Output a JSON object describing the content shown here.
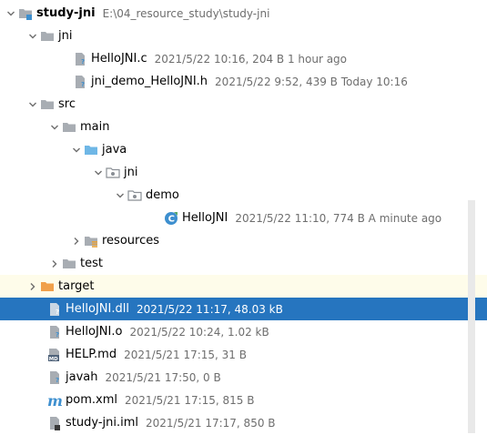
{
  "tree": {
    "project": {
      "name": "study-jni",
      "path": "E:\\04_resource_study\\study-jni"
    },
    "jni_folder": {
      "name": "jni"
    },
    "hellojni_c": {
      "name": "HelloJNI.c",
      "meta": "2021/5/22 10:16, 204 B 1 hour ago"
    },
    "jni_demo_h": {
      "name": "jni_demo_HelloJNI.h",
      "meta": "2021/5/22 9:52, 439 B Today 10:16"
    },
    "src": {
      "name": "src"
    },
    "main": {
      "name": "main"
    },
    "java": {
      "name": "java"
    },
    "pkg_jni": {
      "name": "jni"
    },
    "pkg_demo": {
      "name": "demo"
    },
    "hellojni_class": {
      "name": "HelloJNI",
      "meta": "2021/5/22 11:10, 774 B A minute ago"
    },
    "resources": {
      "name": "resources"
    },
    "test": {
      "name": "test"
    },
    "target": {
      "name": "target"
    },
    "hellojni_dll": {
      "name": "HelloJNI.dll",
      "meta": "2021/5/22 11:17, 48.03 kB"
    },
    "hellojni_o": {
      "name": "HelloJNI.o",
      "meta": "2021/5/22 10:24, 1.02 kB"
    },
    "help_md": {
      "name": "HELP.md",
      "meta": "2021/5/21 17:15, 31 B",
      "icon_text": "MD"
    },
    "javah": {
      "name": "javah",
      "meta": "2021/5/21 17:50, 0 B"
    },
    "pom_xml": {
      "name": "pom.xml",
      "meta": "2021/5/21 17:15, 815 B",
      "icon_text": "m"
    },
    "iml": {
      "name": "study-jni.iml",
      "meta": "2021/5/21 17:17, 850 B"
    }
  },
  "colors": {
    "folder_gray": "#a8adb3",
    "folder_blue": "#6fb7e6",
    "folder_orange": "#f0a04b",
    "selection": "#2675bf",
    "excluded_bg": "#fefcea",
    "meta_text": "#6e6e6e",
    "class_icon": "#3d8fcf"
  },
  "icons": {
    "project": "module-folder-icon",
    "folder": "folder-icon",
    "source_root": "source-root-folder-icon",
    "package": "package-icon",
    "resources": "resources-root-folder-icon",
    "excluded": "excluded-folder-icon",
    "file": "unknown-file-icon",
    "class": "java-class-icon",
    "markdown": "markdown-icon",
    "maven": "maven-icon",
    "iml": "iml-module-icon"
  }
}
